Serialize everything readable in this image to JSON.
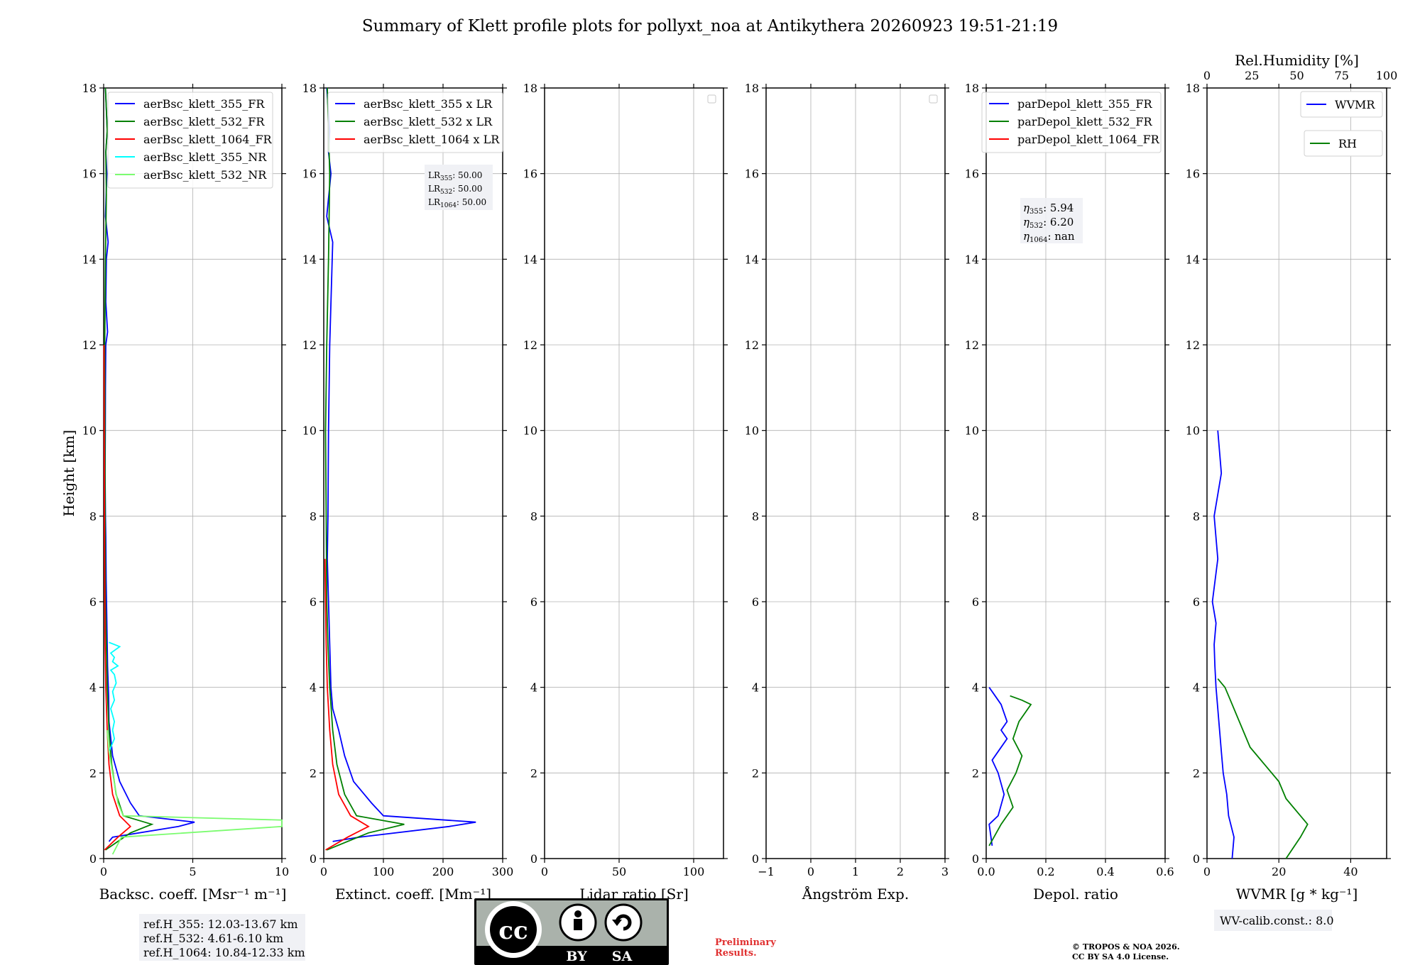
{
  "title": "Summary of Klett profile plots for pollyxt_noa at Antikythera 20260923 19:51-21:19",
  "colors": {
    "blue": "#0000ff",
    "green": "#008000",
    "red": "#ff0000",
    "cyan": "#00ffff",
    "lightgreen": "#7cfc70",
    "grid": "#b0b0b0"
  },
  "chart_data": [
    {
      "id": "backscatter",
      "type": "line",
      "xlabel": "Backsc. coeff. [Msr⁻¹ m⁻¹]",
      "ylabel": "Height [km]",
      "xlim": [
        0,
        10
      ],
      "ylim": [
        0,
        18
      ],
      "xticks": [
        "0",
        "5",
        "10"
      ],
      "yticks": [
        "0",
        "2",
        "4",
        "6",
        "8",
        "10",
        "12",
        "14",
        "16",
        "18"
      ],
      "grid": true,
      "legend": "top-left",
      "series": [
        {
          "name": "aerBsc_klett_355_FR",
          "color": "#0000ff",
          "x": [
            0.3,
            0.5,
            4.2,
            5.1,
            2.0,
            1.5,
            0.9,
            0.5,
            0.35,
            0.3,
            0.28,
            0.22,
            0.18,
            0.14,
            0.12,
            0.1,
            0.08,
            0.09,
            0.1,
            0.12,
            0.22,
            0.12,
            0.15,
            0.25,
            0.1,
            0.18,
            0.12,
            0.2,
            0.1
          ],
          "y": [
            0.4,
            0.5,
            0.75,
            0.85,
            1.0,
            1.3,
            1.8,
            2.4,
            3.0,
            3.2,
            3.8,
            4.5,
            5.5,
            6.5,
            7.5,
            8.0,
            9.0,
            10.0,
            11.0,
            12.0,
            12.3,
            13.0,
            14.0,
            14.4,
            15.0,
            16.0,
            16.5,
            17.0,
            18.0
          ]
        },
        {
          "name": "aerBsc_klett_532_FR",
          "color": "#008000",
          "x": [
            0.1,
            1.5,
            2.7,
            1.1,
            0.7,
            0.45,
            0.3,
            0.2,
            0.15,
            0.1,
            0.08,
            0.07,
            0.06,
            0.1,
            0.15,
            0.12,
            0.2,
            0.15,
            0.1
          ],
          "y": [
            0.2,
            0.6,
            0.8,
            1.0,
            1.5,
            2.2,
            3.0,
            4.0,
            5.0,
            6.0,
            8.0,
            10.0,
            12.0,
            14.0,
            15.5,
            16.5,
            17.0,
            17.5,
            18.0
          ]
        },
        {
          "name": "aerBsc_klett_1064_FR",
          "color": "#ff0000",
          "x": [
            0.05,
            0.8,
            1.5,
            0.9,
            0.5,
            0.3,
            0.2,
            0.12,
            0.08,
            0.05,
            0.03,
            0.02
          ],
          "y": [
            0.2,
            0.5,
            0.75,
            1.0,
            1.5,
            2.2,
            3.0,
            4.0,
            5.0,
            7.0,
            10.0,
            12.0
          ]
        },
        {
          "name": "aerBsc_klett_355_NR",
          "color": "#00ffff",
          "x": [
            0.3,
            0.6,
            0.5,
            0.6,
            0.4,
            0.6,
            0.5,
            0.7,
            0.6,
            0.4,
            0.8,
            0.5,
            0.6,
            0.4,
            0.9,
            0.6,
            0.3
          ],
          "y": [
            2.5,
            2.8,
            3.0,
            3.2,
            3.5,
            3.7,
            3.9,
            4.1,
            4.3,
            4.4,
            4.5,
            4.6,
            4.7,
            4.8,
            4.95,
            5.0,
            5.05
          ]
        },
        {
          "name": "aerBsc_klett_532_NR",
          "color": "#7cfc70",
          "x": [
            0.5,
            1.0,
            10,
            10,
            1.1,
            0.8,
            0.5,
            0.3,
            0.2
          ],
          "y": [
            0.1,
            0.5,
            0.75,
            0.9,
            1.0,
            1.3,
            2.0,
            2.5,
            3.0
          ]
        }
      ],
      "annotations": [
        "ref.H_355: 12.03-13.67 km",
        "ref.H_532: 4.61-6.10 km",
        "ref.H_1064: 10.84-12.33 km"
      ]
    },
    {
      "id": "extinction",
      "type": "line",
      "xlabel": "Extinct. coeff. [Mm⁻¹]",
      "xlim": [
        0,
        300
      ],
      "ylim": [
        0,
        18
      ],
      "xticks": [
        "0",
        "100",
        "200",
        "300"
      ],
      "yticks": [
        "0",
        "2",
        "4",
        "6",
        "8",
        "10",
        "12",
        "14",
        "16",
        "18"
      ],
      "grid": true,
      "legend": "top-left",
      "series": [
        {
          "name": "aerBsc_klett_355 x LR",
          "color": "#0000ff",
          "x": [
            15,
            60,
            210,
            255,
            100,
            80,
            50,
            35,
            25,
            15,
            12,
            10,
            8,
            6,
            7,
            8,
            10,
            15,
            5,
            12,
            8,
            10,
            5
          ],
          "y": [
            0.4,
            0.5,
            0.75,
            0.85,
            1.0,
            1.3,
            1.8,
            2.4,
            3.0,
            3.5,
            4.0,
            5.0,
            6.0,
            7.0,
            8.0,
            10.0,
            12.0,
            14.4,
            15.0,
            16.0,
            16.5,
            17.0,
            18.0
          ]
        },
        {
          "name": "aerBsc_klett_532 x LR",
          "color": "#008000",
          "x": [
            5,
            75,
            135,
            55,
            35,
            22,
            15,
            10,
            7,
            5,
            4,
            3,
            5,
            8,
            10,
            6
          ],
          "y": [
            0.2,
            0.6,
            0.8,
            1.0,
            1.5,
            2.2,
            3.0,
            4.0,
            5.0,
            6.0,
            8.0,
            10.0,
            12.0,
            14.0,
            16.0,
            18.0
          ]
        },
        {
          "name": "aerBsc_klett_1064 x LR",
          "color": "#ff0000",
          "x": [
            3,
            40,
            75,
            45,
            25,
            15,
            10,
            6,
            4,
            2
          ],
          "y": [
            0.2,
            0.5,
            0.75,
            1.0,
            1.5,
            2.2,
            3.0,
            4.0,
            5.0,
            7.0
          ]
        }
      ],
      "lr_labels": [
        "LR",
        "LR",
        "LR"
      ],
      "lr_subs": [
        "355",
        "532",
        "1064"
      ],
      "lr_values": [
        ": 50.00",
        ": 50.00",
        ": 50.00"
      ]
    },
    {
      "id": "lidar-ratio",
      "type": "line",
      "xlabel": "Lidar ratio [Sr]",
      "xlim": [
        0,
        120
      ],
      "ylim": [
        0,
        18
      ],
      "xticks": [
        "0",
        "50",
        "100"
      ],
      "yticks": [
        "0",
        "2",
        "4",
        "6",
        "8",
        "10",
        "12",
        "14",
        "16",
        "18"
      ],
      "grid": true,
      "legend": "top-right",
      "series": []
    },
    {
      "id": "angstrom",
      "type": "line",
      "xlabel": "Ångström Exp.",
      "xlim": [
        -1,
        3
      ],
      "ylim": [
        0,
        18
      ],
      "xticks": [
        "−1",
        "0",
        "1",
        "2",
        "3"
      ],
      "yticks": [
        "0",
        "2",
        "4",
        "6",
        "8",
        "10",
        "12",
        "14",
        "16",
        "18"
      ],
      "grid": true,
      "legend": "top-right",
      "series": []
    },
    {
      "id": "depol",
      "type": "line",
      "xlabel": "Depol. ratio",
      "xlim": [
        0,
        0.6
      ],
      "ylim": [
        0,
        18
      ],
      "xticks": [
        "0.0",
        "0.2",
        "0.4",
        "0.6"
      ],
      "yticks": [
        "0",
        "2",
        "4",
        "6",
        "8",
        "10",
        "12",
        "14",
        "16",
        "18"
      ],
      "grid": true,
      "legend": "top-left",
      "series": [
        {
          "name": "parDepol_klett_355_FR",
          "color": "#0000ff",
          "x": [
            0.02,
            0.01,
            0.04,
            0.06,
            0.04,
            0.02,
            0.04,
            0.07,
            0.05,
            0.07,
            0.06,
            0.05,
            0.03,
            0.01
          ],
          "y": [
            0.3,
            0.8,
            1.0,
            1.5,
            2.0,
            2.3,
            2.5,
            2.8,
            3.0,
            3.2,
            3.4,
            3.6,
            3.8,
            4.0
          ]
        },
        {
          "name": "parDepol_klett_532_FR",
          "color": "#008000",
          "x": [
            0.01,
            0.05,
            0.09,
            0.07,
            0.1,
            0.12,
            0.09,
            0.1,
            0.11,
            0.13,
            0.15,
            0.12,
            0.08
          ],
          "y": [
            0.3,
            0.8,
            1.2,
            1.6,
            2.0,
            2.4,
            2.8,
            3.0,
            3.2,
            3.4,
            3.6,
            3.7,
            3.8
          ]
        },
        {
          "name": "parDepol_klett_1064_FR",
          "color": "#ff0000",
          "x": [],
          "y": []
        }
      ],
      "eta_labels": [
        "η",
        "η",
        "η"
      ],
      "eta_subs": [
        "355",
        "532",
        "1064"
      ],
      "eta_values": [
        ": 5.94",
        ": 6.20",
        ": nan"
      ]
    },
    {
      "id": "wvmr",
      "type": "line",
      "xlabel": "WVMR [g * kg⁻¹]",
      "toplabel": "Rel.Humidity [%]",
      "xlim": [
        0,
        50
      ],
      "ylim": [
        0,
        18
      ],
      "xticks": [
        "0",
        "20",
        "40"
      ],
      "topticks": [
        "0",
        "25",
        "50",
        "75",
        "100"
      ],
      "yticks": [
        "0",
        "2",
        "4",
        "6",
        "8",
        "10",
        "12",
        "14",
        "16",
        "18"
      ],
      "grid": true,
      "legend": "top-right",
      "series": [
        {
          "name": "WVMR",
          "color": "#0000ff",
          "x": [
            7,
            7.5,
            6,
            5.5,
            4.5,
            4,
            3.5,
            3,
            2.5,
            2.2,
            2,
            2.5,
            1.5,
            3,
            2,
            4,
            3
          ],
          "y": [
            0,
            0.5,
            1.0,
            1.5,
            2.0,
            2.5,
            3.0,
            3.5,
            4.0,
            4.5,
            5.0,
            5.5,
            6.0,
            7.0,
            8.0,
            9.0,
            10.0
          ]
        },
        {
          "name": "RH",
          "color": "#008000",
          "x": [
            22,
            26,
            28,
            26,
            22,
            20,
            16,
            12,
            10,
            8,
            6,
            5,
            3
          ],
          "y": [
            0,
            0.5,
            0.8,
            1.0,
            1.4,
            1.8,
            2.2,
            2.6,
            3.0,
            3.4,
            3.8,
            4.0,
            4.2
          ]
        }
      ],
      "annotation": "WV-calib.const.: 8.0"
    }
  ],
  "footer": {
    "preliminary_line1": "Preliminary",
    "preliminary_line2": "Results.",
    "copyright_line1": "© TROPOS & NOA 2026.",
    "copyright_line2": "CC BY SA 4.0 License.",
    "cc_by": "BY",
    "cc_sa": "SA",
    "cc_mark": "cc"
  }
}
